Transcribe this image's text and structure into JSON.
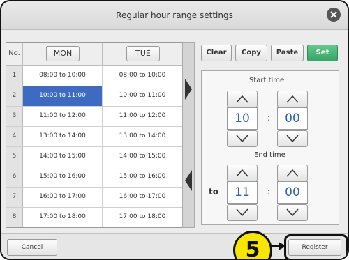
{
  "window": {
    "title": "Regular hour range settings",
    "close_icon": "close-icon",
    "register_outline_color": "#111111",
    "callout_color": "#f6e600"
  },
  "table": {
    "header_no": "No.",
    "days": [
      "MON",
      "TUE"
    ],
    "rows": [
      {
        "no": "1",
        "mon": "08:00 to 10:00",
        "tue": "08:00 to 10:00"
      },
      {
        "no": "2",
        "mon": "10:00 to 11:00",
        "tue": "10:00 to 11:00"
      },
      {
        "no": "3",
        "mon": "11:00 to 12:00",
        "tue": "11:00 to 12:00"
      },
      {
        "no": "4",
        "mon": "13:00 to 14:00",
        "tue": "13:00 to 14:00"
      },
      {
        "no": "5",
        "mon": "14:00 to 15:00",
        "tue": "14:00 to 15:00"
      },
      {
        "no": "6",
        "mon": "15:00 to 16:00",
        "tue": "15:00 to 16:00"
      },
      {
        "no": "7",
        "mon": "16:00 to 17:00",
        "tue": "16:00 to 17:00"
      },
      {
        "no": "8",
        "mon": "17:00 to 18:00",
        "tue": "17:00 to 18:00"
      }
    ],
    "selected_cell": "row 2 MON",
    "selection_color": "#3d6bc1"
  },
  "arrows": {
    "top_icon": "triangle-right-icon",
    "bottom_icon": "triangle-left-icon"
  },
  "toolbar": {
    "clear": "Clear",
    "copy": "Copy",
    "paste": "Paste",
    "set": "Set",
    "set_color": "#3aa367"
  },
  "start_time": {
    "label": "Start time",
    "hour": "10",
    "minute": "00",
    "separator": ":"
  },
  "end_time": {
    "label": "End time",
    "prefix": "to",
    "hour": "11",
    "minute": "00",
    "separator": ":"
  },
  "footer": {
    "cancel": "Cancel",
    "register": "Register",
    "callout_number": "5"
  }
}
